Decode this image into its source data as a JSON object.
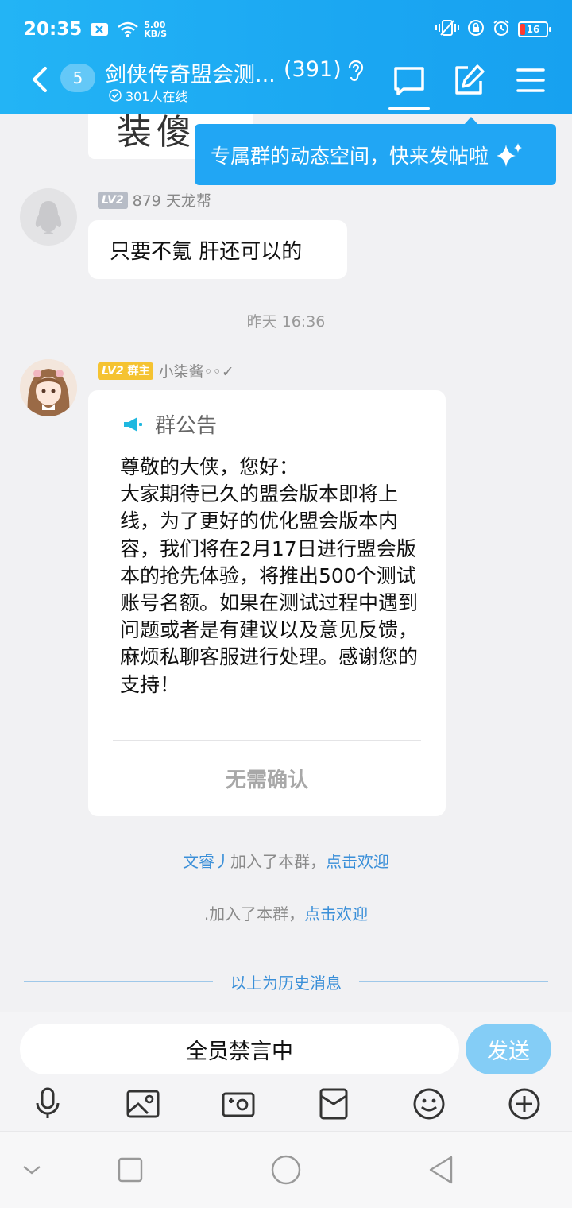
{
  "status_bar": {
    "time": "20:35",
    "net_speed_value": "5.00",
    "net_speed_unit": "KB/S",
    "battery": "16"
  },
  "header": {
    "unread_count": "5",
    "group_name": "剑侠传奇盟会测...",
    "member_count": "(391)",
    "online_text": "301人在线"
  },
  "tooltip": {
    "text": "专属群的动态空间，快来发帖啦"
  },
  "partial_image": {
    "text": "装傻"
  },
  "messages": [
    {
      "level": "LV2",
      "sender": "879 天龙帮",
      "text": "只要不氪 肝还可以的"
    },
    {
      "level": "LV2",
      "role": "群主",
      "sender": "小柒酱◦◦✓"
    }
  ],
  "timestamp": "昨天 16:36",
  "notice": {
    "title": "群公告",
    "body": "尊敬的大侠，您好：\n大家期待已久的盟会版本即将上线，为了更好的优化盟会版本内容，我们将在2月17日进行盟会版本的抢先体验，将推出500个测试账号名额。如果在测试过程中遇到问题或者是有建议以及意见反馈，麻烦私聊客服进行处理。感谢您的支持！",
    "confirm_label": "无需确认"
  },
  "system_messages": [
    {
      "user": "文睿丿",
      "action": "加入了本群，",
      "link": "点击欢迎"
    },
    {
      "user": ".",
      "action": "加入了本群，",
      "link": "点击欢迎"
    }
  ],
  "history_divider": "以上为历史消息",
  "input": {
    "placeholder": "全员禁言中",
    "send_label": "发送"
  },
  "toolbar_icons": [
    "microphone-icon",
    "image-icon",
    "camera-icon",
    "red-packet-icon",
    "emoji-icon",
    "plus-icon"
  ],
  "colors": {
    "header": "#1ba7f2",
    "link": "#3a8fd8",
    "send_button": "#84cdf6",
    "owner_badge": "#f5c331"
  }
}
